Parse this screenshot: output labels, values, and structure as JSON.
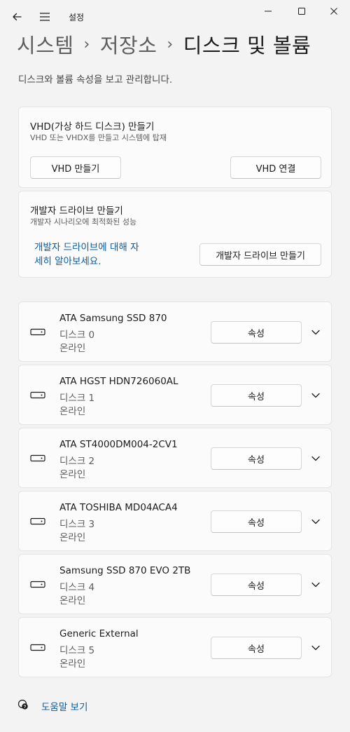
{
  "window": {
    "title": "설정"
  },
  "breadcrumb": {
    "items": [
      "시스템",
      "저장소"
    ],
    "current": "디스크 및 볼륨"
  },
  "page": {
    "description": "디스크와 볼륨 속성을 보고 관리합니다."
  },
  "vhd_card": {
    "title": "VHD(가상 하드 디스크) 만들기",
    "subtitle": "VHD 또는 VHDX를 만들고 시스템에 탑재",
    "create_label": "VHD 만들기",
    "attach_label": "VHD 연결"
  },
  "dev_card": {
    "title": "개발자 드라이브 만들기",
    "subtitle": "개발자 시나리오에 최적화된 성능",
    "link_line1": "개발자 드라이브에 대해 자",
    "link_line2": "세히 알아보세요.",
    "create_label": "개발자 드라이브 만들기"
  },
  "disks": [
    {
      "name": "ATA Samsung SSD 870",
      "number": "디스크 0",
      "status": "온라인",
      "button": "속성"
    },
    {
      "name": "ATA HGST HDN726060AL",
      "number": "디스크 1",
      "status": "온라인",
      "button": "속성"
    },
    {
      "name": "ATA ST4000DM004-2CV1",
      "number": "디스크 2",
      "status": "온라인",
      "button": "속성"
    },
    {
      "name": "ATA TOSHIBA MD04ACA4",
      "number": "디스크 3",
      "status": "온라인",
      "button": "속성"
    },
    {
      "name": "Samsung SSD 870 EVO 2TB",
      "number": "디스크 4",
      "status": "온라인",
      "button": "속성"
    },
    {
      "name": "Generic External",
      "number": "디스크 5",
      "status": "온라인",
      "button": "속성"
    }
  ],
  "help": {
    "label": "도움말 보기"
  },
  "icons": {
    "back": "back-arrow-icon",
    "menu": "hamburger-menu-icon",
    "disk": "hard-drive-icon",
    "expand": "chevron-down-icon",
    "help": "help-chat-icon"
  },
  "colors": {
    "background": "#f3f3f3",
    "card": "#fbfbfb",
    "link": "#0a5a9c"
  }
}
